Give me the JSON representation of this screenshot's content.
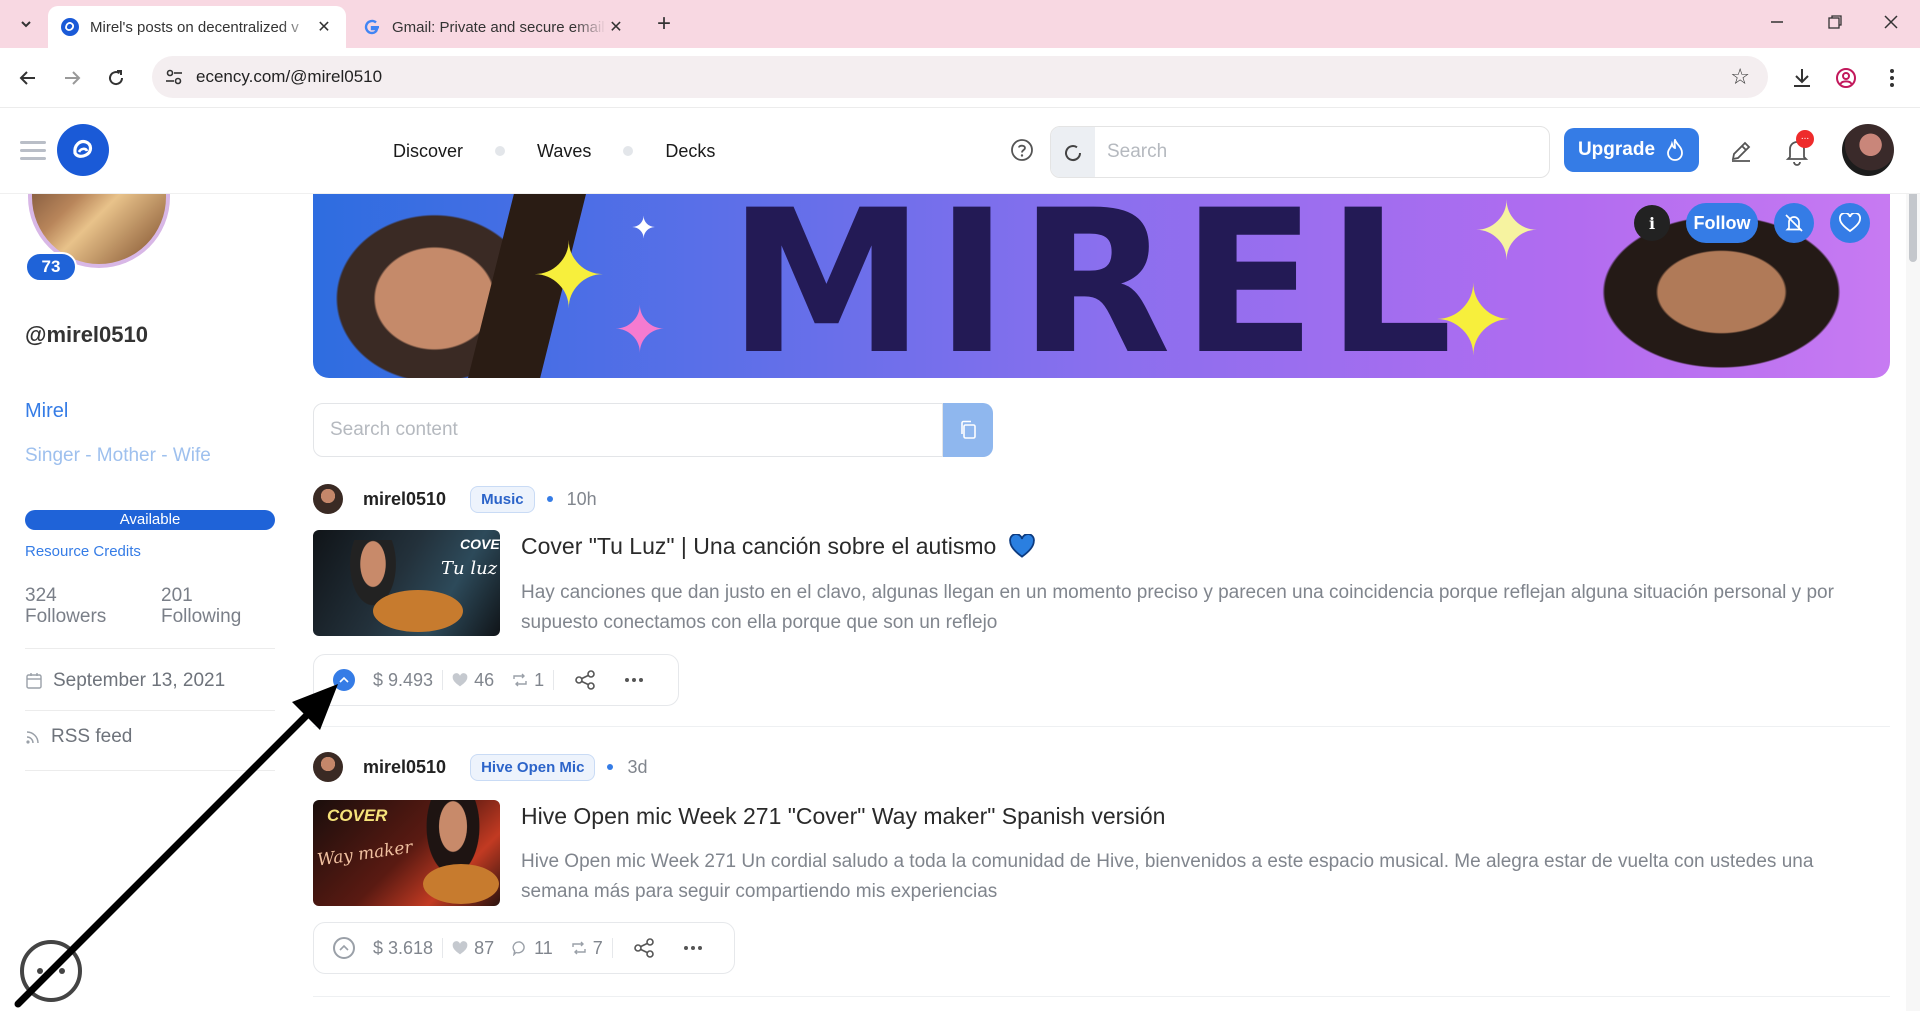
{
  "browser": {
    "tabs": [
      {
        "title": "Mirel's posts on decentralized v",
        "active": true
      },
      {
        "title": "Gmail: Private and secure email",
        "active": false
      }
    ],
    "url": "ecency.com/@mirel0510"
  },
  "header": {
    "nav": [
      "Discover",
      "Waves",
      "Decks"
    ],
    "search_placeholder": "Search",
    "upgrade_label": "Upgrade",
    "notification_badge": "..."
  },
  "profile": {
    "reputation": "73",
    "username": "@mirel0510",
    "display_name": "Mirel",
    "about": "Singer - Mother - Wife",
    "rc_status": "Available",
    "rc_label": "Resource Credits",
    "followers_count": "324",
    "followers_label": "Followers",
    "following_count": "201",
    "following_label": "Following",
    "joined": "September 13, 2021",
    "rss_label": "RSS feed"
  },
  "cover": {
    "title": "MIREL",
    "info_label": "i",
    "follow_label": "Follow"
  },
  "content_search": {
    "placeholder": "Search content"
  },
  "posts": [
    {
      "author": "mirel0510",
      "tag": "Music",
      "time": "10h",
      "thumb_text_top": "COVER",
      "thumb_text_bottom": "Tu luz",
      "title": "Cover \"Tu Luz\" | Una canción sobre el autismo",
      "excerpt": "Hay canciones que dan justo en el clavo, algunas llegan en un momento preciso y parecen una coincidencia porque reflejan alguna situación personal y por supuesto conectamos con ella porque que son un reflejo",
      "payout": "$ 9.493",
      "votes": "46",
      "comments": "",
      "reblogs": "1",
      "voted": true
    },
    {
      "author": "mirel0510",
      "tag": "Hive Open Mic",
      "time": "3d",
      "thumb_text_top": "COVER",
      "thumb_text_bottom": "Way maker",
      "title": "Hive Open mic Week 271 \"Cover\" Way maker\" Spanish versión",
      "excerpt": "Hive Open mic Week 271 Un cordial saludo a toda la comunidad de Hive, bienvenidos a este espacio musical. Me alegra estar de vuelta con ustedes una semana más para seguir compartiendo mis experiencias",
      "payout": "$ 3.618",
      "votes": "87",
      "comments": "11",
      "reblogs": "7",
      "voted": false
    }
  ],
  "colors": {
    "accent": "#357ce6",
    "brand": "#1a5ad7",
    "tabbar": "#f8d8e2"
  }
}
